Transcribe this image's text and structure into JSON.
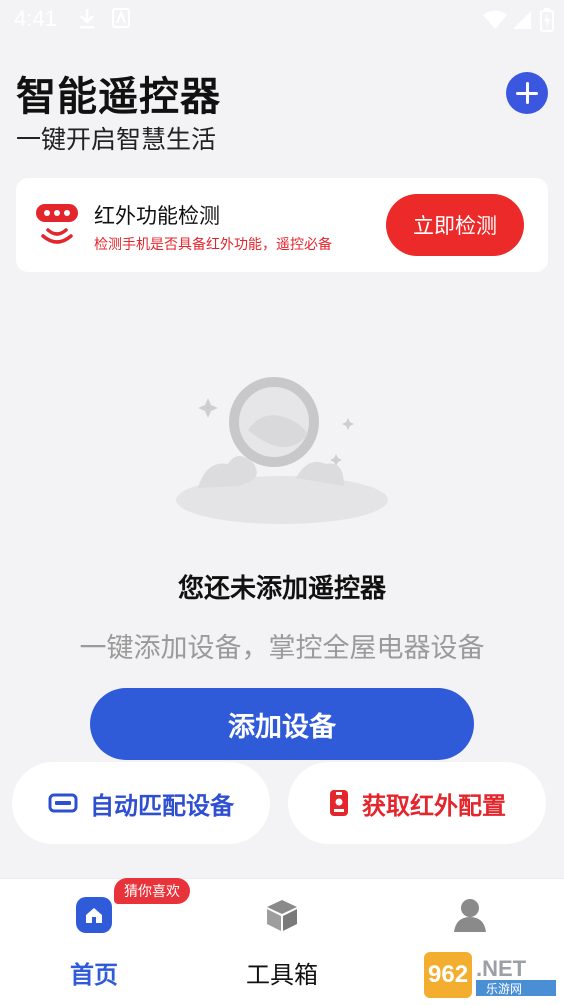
{
  "status_bar": {
    "time": "4:41"
  },
  "header": {
    "title": "智能遥控器",
    "subtitle": "一键开启智慧生活"
  },
  "ir_card": {
    "title": "红外功能检测",
    "description": "检测手机是否具备红外功能，遥控必备",
    "button_label": "立即检测"
  },
  "empty_state": {
    "title": "您还未添加遥控器",
    "description": "一键添加设备，掌控全屋电器设备",
    "add_button_label": "添加设备"
  },
  "actions": {
    "auto_match_label": "自动匹配设备",
    "ir_config_label": "获取红外配置"
  },
  "bottom_nav": {
    "badge": "猜你喜欢",
    "items": [
      {
        "label": "首页",
        "icon": "home-icon",
        "active": true
      },
      {
        "label": "工具箱",
        "icon": "toolbox-icon",
        "active": false
      },
      {
        "label": "",
        "icon": "profile-icon",
        "active": false
      }
    ]
  },
  "watermark": {
    "text": "962.NET",
    "subtext": "乐游网"
  },
  "colors": {
    "primary_blue": "#2f5bd9",
    "accent_red": "#ec2a2a",
    "background": "#f3f3f5"
  }
}
